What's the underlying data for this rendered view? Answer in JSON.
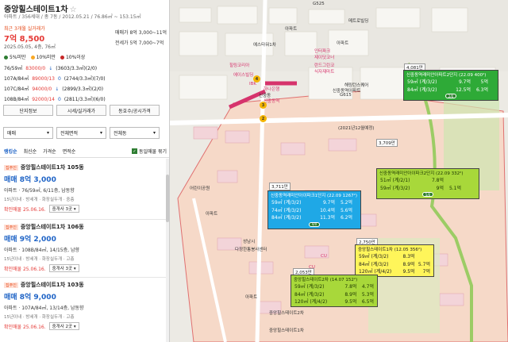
{
  "header": {
    "title": "중앙힐스테이트1차",
    "star": "☆",
    "subinfo": "아파트 / 356세대 / 총 7동 / 2012.05.21 / 76.86㎡ ~ 153.15㎡",
    "recent_label": "최근 3개월 실거래가",
    "recent_price": "7억 8,500",
    "recent_date": "2025.05.05, 4층, 76㎡",
    "sale_range": "매매가 8억 3,000~11억",
    "jeonse_range": "전세가 5억 7,000~7억"
  },
  "legend": {
    "items": [
      {
        "label": "5%미만",
        "color": "#2e7d32"
      },
      {
        "label": "10%미만",
        "color": "#f9a825"
      },
      {
        "label": "10%이상",
        "color": "#c62828"
      }
    ]
  },
  "areas": [
    {
      "size": "76/59㎡",
      "price": "83000/0",
      "icon": "↓",
      "detail": "(3603/3.3㎡)(2/0)"
    },
    {
      "size": "107A/84㎡",
      "price": "89000/13",
      "icon": "0",
      "detail": "(2744/3.3㎡)(7/0)"
    },
    {
      "size": "107C/84㎡",
      "price": "94000/0",
      "icon": "↓",
      "detail": "(2899/3.3㎡)(2/0)"
    },
    {
      "size": "108B/84㎡",
      "price": "92000/14",
      "icon": "0",
      "detail": "(2811/3.3㎡)(6/0)"
    }
  ],
  "tabs": [
    "단지정보",
    "시세/실거래가",
    "동호수/공시가격"
  ],
  "filters": [
    {
      "label": "매매",
      "arrow": "▾"
    },
    {
      "label": "전체면적",
      "arrow": "▾"
    },
    {
      "label": "전체동",
      "arrow": "▾"
    }
  ],
  "sort": {
    "items": [
      "랭킹순",
      "최신순",
      "가격순",
      "면적순"
    ],
    "check_mark": "✓",
    "same_listing": "동일매물 묶기"
  },
  "listings": [
    {
      "badge": "집주인",
      "name": "중앙힐스테이트1차 105동",
      "price": "매매 8억 3,000",
      "desc": "아파트 · 76/59㎡, 6/11층, 남동향",
      "tags": "15년이내 · 방세개 · 화장실두개 · 중층",
      "confirm": "확인매물 25.06.16.",
      "agent": "중개사 3곳 ▾"
    },
    {
      "badge": "집주인",
      "name": "중앙힐스테이트1차 106동",
      "price": "매매 9억 2,000",
      "desc": "아파트 · 108B/84㎡, 14/15층, 남향",
      "tags": "15년이내 · 방세개 · 화장실두개 · 고층",
      "confirm": "확인매물 25.06.16.",
      "agent": "중개사 3곳 ▾"
    },
    {
      "badge": "집주인",
      "name": "중앙힐스테이트1차 103동",
      "price": "매매 8억 9,000",
      "desc": "아파트 · 107A/84㎡, 13/14층, 남동향",
      "tags": "15년이내 · 방세개 · 화장실두개 · 고층",
      "confirm": "확인매물 25.06.16.",
      "agent": "중개사 2곳 ▾"
    }
  ],
  "map": {
    "labels": [
      {
        "t": "G525",
        "c": "lot"
      },
      {
        "t": "아파트",
        "c": "lot"
      },
      {
        "t": "아파트",
        "c": "lot"
      },
      {
        "t": "예스타워1차",
        "c": "lot"
      },
      {
        "t": "메트로빌딩",
        "c": "lot"
      },
      {
        "t": "신중동역",
        "c": "poi"
      },
      {
        "t": "IBK",
        "c": "poi"
      },
      {
        "t": "하나은행",
        "c": "poi"
      },
      {
        "t": "힐링코리아",
        "c": "poi"
      },
      {
        "t": "에이스빌딩",
        "c": "poi"
      },
      {
        "t": "인터파크",
        "c": "poi"
      },
      {
        "t": "제이닷코너",
        "c": "poi"
      },
      {
        "t": "란드그린코",
        "c": "poi"
      },
      {
        "t": "식자재마트",
        "c": "poi"
      },
      {
        "t": "신중동",
        "c": "lot"
      },
      {
        "t": "G615",
        "c": "lot"
      },
      {
        "t": "해링턴스퀘어",
        "c": "lot"
      },
      {
        "t": "신중동역아파트",
        "c": "lot"
      },
      {
        "t": "(2021년12월예정)",
        "c": "lot"
      },
      {
        "t": "어린이공원",
        "c": "lot"
      },
      {
        "t": "아파트",
        "c": "lot"
      },
      {
        "t": "성남시",
        "c": "lot"
      },
      {
        "t": "다정한통봉사센터",
        "c": "lot"
      },
      {
        "t": "CU",
        "c": "poi"
      },
      {
        "t": "CU",
        "c": "poi"
      },
      {
        "t": "아파트",
        "c": "lot"
      },
      {
        "t": "중앙힐스테이트2차",
        "c": "lot"
      },
      {
        "t": "GS25",
        "c": "lot"
      },
      {
        "t": "중앙힐스테이트1차",
        "c": "lot"
      }
    ],
    "price_pins": [
      "4,081만",
      "3,709만",
      "3,711만",
      "2,750만",
      "2,053만"
    ],
    "boxes": [
      {
        "head": "신중동역래미안아파트2단지 (22.09 400²)",
        "rows": [
          [
            "59㎡ (계/3/2)",
            "9.7억",
            "5억"
          ],
          [
            "84㎡ (계/3/2)",
            "12.5억",
            "6.3억"
          ]
        ],
        "style": "green",
        "mini": "2/0"
      },
      {
        "head": "신중동역래미안아이파크2단지 (22.09 332²)",
        "rows": [
          [
            "51㎡ (계/2/1)",
            "7.8억",
            ""
          ],
          [
            "59㎡ (계/3/2)",
            "9억",
            "5.1억"
          ]
        ],
        "style": "lime",
        "mini": "5/0"
      },
      {
        "head": "신중동역래미안아이파크1단지 (22.09 1267²)",
        "rows": [
          [
            "59㎡ (계/3/2)",
            "9.7억",
            "5.2억"
          ],
          [
            "74㎡ (계/3/2)",
            "10.4억",
            "5.6억"
          ],
          [
            "84㎡ (계/3/2)",
            "11.3억",
            "6.2억"
          ]
        ],
        "style": "blue",
        "mini": "4/0"
      },
      {
        "head": "중앙힐스테이트1차 (12.05 356²)",
        "rows": [
          [
            "59㎡ (계/3/2)",
            "8.3억",
            ""
          ],
          [
            "84㎡ (계/3/2)",
            "8.9억",
            "5.7억"
          ],
          [
            "120㎡ (계/4/2)",
            "9.5억",
            "7억"
          ]
        ],
        "style": "yellow",
        "mini": ""
      },
      {
        "head": "중앙힐스테이트2차 (14.07 152²)",
        "rows": [
          [
            "59㎡ (계/3/2)",
            "7.8억",
            "4.7억"
          ],
          [
            "84㎡ (계/3/2)",
            "8.9억",
            "5.3억"
          ],
          [
            "120㎡ (계/4/2)",
            "9.5억",
            "6.5억"
          ]
        ],
        "style": "lime",
        "mini": ""
      }
    ],
    "stations": [
      "2",
      "3",
      "4"
    ]
  }
}
